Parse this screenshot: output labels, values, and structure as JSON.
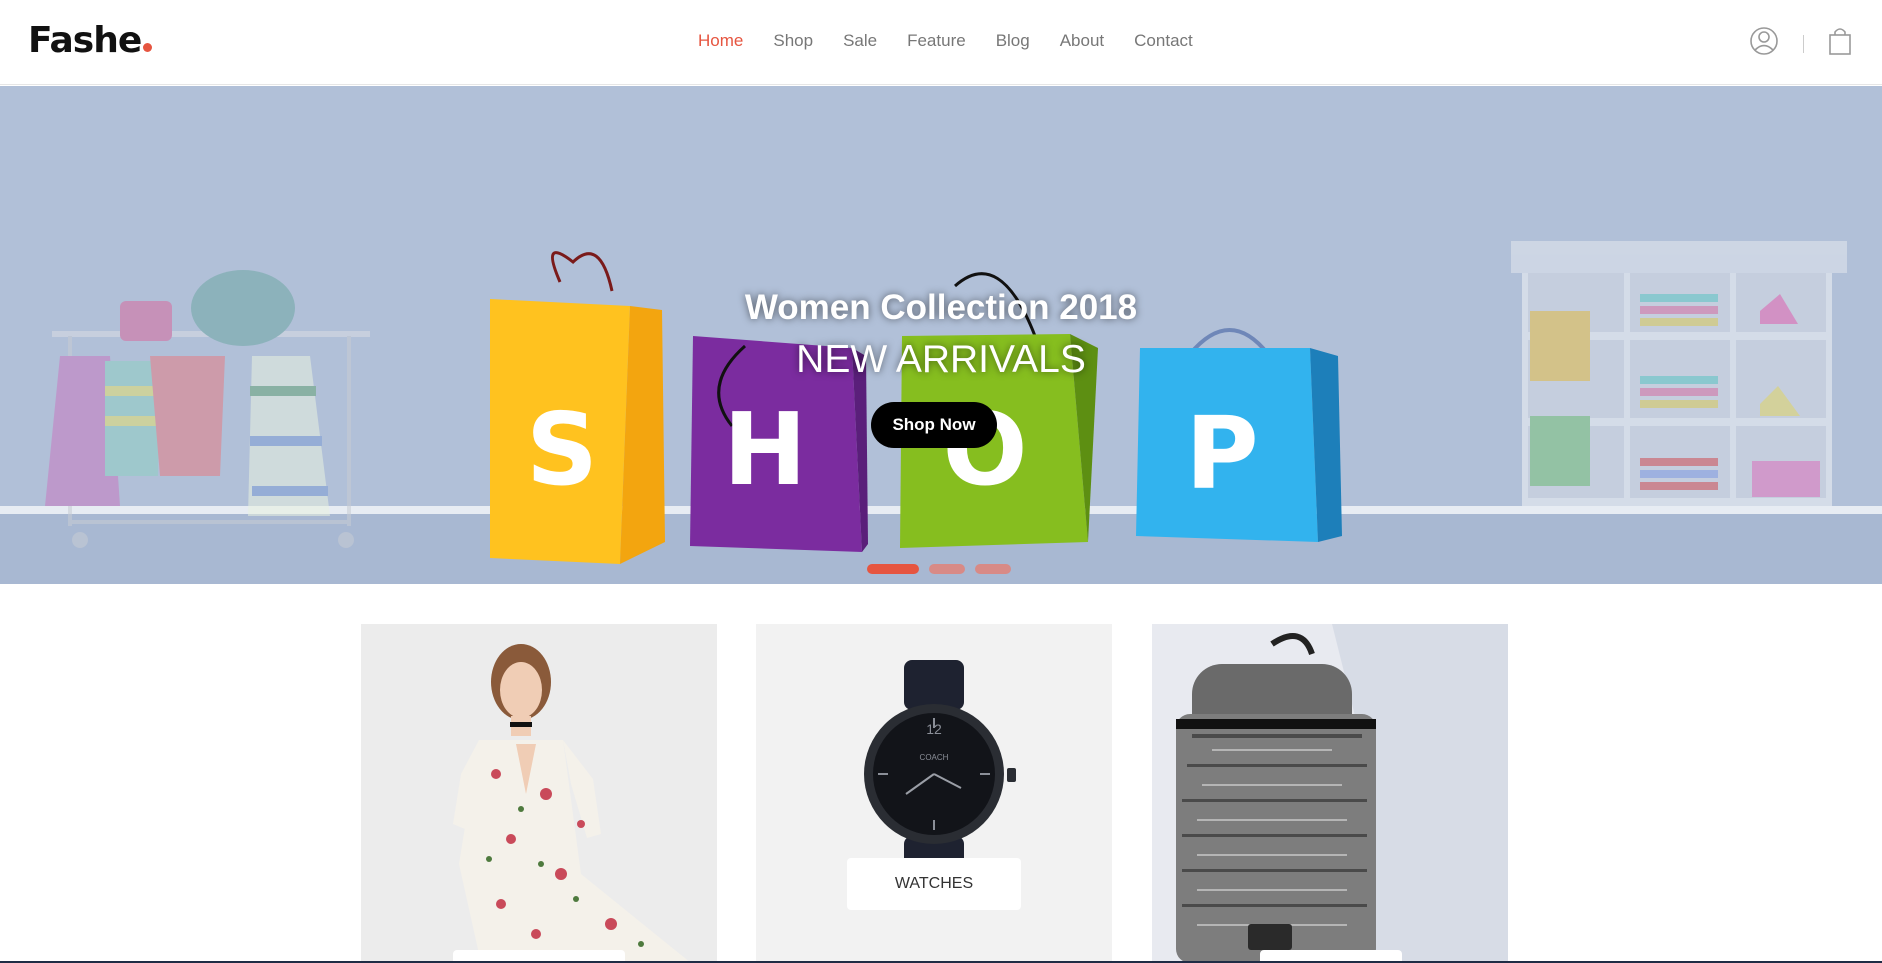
{
  "brand": {
    "name": "Fashe",
    "dot_color": "#e65540"
  },
  "nav": {
    "items": [
      {
        "label": "Home",
        "active": true
      },
      {
        "label": "Shop",
        "active": false
      },
      {
        "label": "Sale",
        "active": false
      },
      {
        "label": "Feature",
        "active": false
      },
      {
        "label": "Blog",
        "active": false
      },
      {
        "label": "About",
        "active": false
      },
      {
        "label": "Contact",
        "active": false
      }
    ],
    "active_color": "#e65540"
  },
  "header_icons": [
    "user-icon",
    "shopping-bag-icon"
  ],
  "hero": {
    "title": "Women Collection 2018",
    "subtitle": "NEW ARRIVALS",
    "button_label": "Shop Now",
    "bag_letters": [
      "S",
      "H",
      "O",
      "P"
    ],
    "slides": {
      "count": 3,
      "active_index": 0
    },
    "background_color": "#b1c0d8"
  },
  "categories": [
    {
      "label": "",
      "image": "floral-dress-model"
    },
    {
      "label": "WATCHES",
      "image": "black-watch"
    },
    {
      "label": "",
      "image": "knit-backpack"
    }
  ]
}
